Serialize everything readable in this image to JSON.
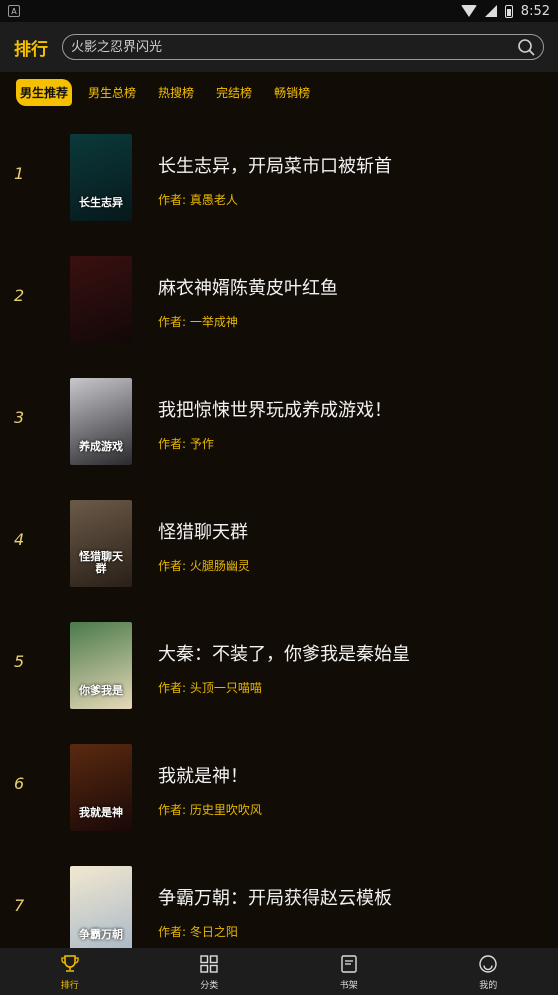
{
  "status_bar": {
    "time": "8:52",
    "left_icon": "A"
  },
  "header": {
    "title": "排行"
  },
  "search": {
    "placeholder": "火影之忍界闪光"
  },
  "tabs": [
    {
      "label": "男生推荐",
      "active": true
    },
    {
      "label": "男生总榜"
    },
    {
      "label": "热搜榜"
    },
    {
      "label": "完结榜"
    },
    {
      "label": "畅销榜"
    }
  ],
  "books": [
    {
      "rank": "1",
      "title": "长生志异，开局菜市口被斩首",
      "author": "作者: 真愚老人",
      "cover_text": "长生志异",
      "cover_colors": [
        "#0b3a3a",
        "#07181c"
      ]
    },
    {
      "rank": "2",
      "title": "麻衣神婿陈黄皮叶红鱼",
      "author": "作者: 一举成神",
      "cover_text": "",
      "cover_colors": [
        "#3a1010",
        "#120808"
      ]
    },
    {
      "rank": "3",
      "title": "我把惊悚世界玩成养成游戏！",
      "author": "作者: 予作",
      "cover_text": "养成游戏",
      "cover_colors": [
        "#c8c8cc",
        "#2a2a2e"
      ]
    },
    {
      "rank": "4",
      "title": "怪猎聊天群",
      "author": "作者: 火腿肠幽灵",
      "cover_text": "怪猎聊天群",
      "cover_colors": [
        "#6b5a48",
        "#2a2018"
      ]
    },
    {
      "rank": "5",
      "title": "大秦：不装了，你爹我是秦始皇",
      "author": "作者: 头顶一只喵喵",
      "cover_text": "你爹我是",
      "cover_colors": [
        "#4a7a4a",
        "#e6d8b8"
      ]
    },
    {
      "rank": "6",
      "title": "我就是神！",
      "author": "作者: 历史里吹吹风",
      "cover_text": "我就是神",
      "cover_colors": [
        "#5a2a10",
        "#1a0808"
      ]
    },
    {
      "rank": "7",
      "title": "争霸万朝：开局获得赵云模板",
      "author": "作者: 冬日之阳",
      "cover_text": "争霸万朝",
      "cover_colors": [
        "#f2e8d0",
        "#a8b8c8"
      ]
    }
  ],
  "bottom_nav": [
    {
      "label": "排行",
      "icon": "trophy-icon",
      "active": true
    },
    {
      "label": "分类",
      "icon": "grid-icon"
    },
    {
      "label": "书架",
      "icon": "bookshelf-icon"
    },
    {
      "label": "我的",
      "icon": "smiley-icon"
    }
  ],
  "colors": {
    "accent": "#f5c000",
    "background": "#120c06",
    "bar": "#1d1d1d"
  }
}
